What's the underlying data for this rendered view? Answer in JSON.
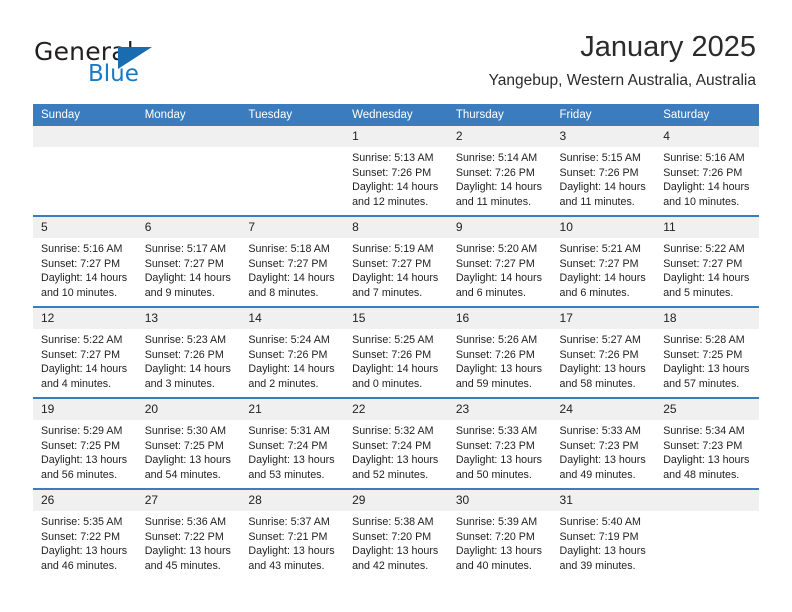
{
  "logo": {
    "word1": "General",
    "word2": "Blue",
    "accent_color": "#1a7ac4"
  },
  "header": {
    "title": "January 2025",
    "subtitle": "Yangebup, Western Australia, Australia"
  },
  "calendar": {
    "header_color": "#3b7cbf",
    "weekday_headers": [
      "Sunday",
      "Monday",
      "Tuesday",
      "Wednesday",
      "Thursday",
      "Friday",
      "Saturday"
    ],
    "weeks": [
      [
        {
          "day": "",
          "lines": []
        },
        {
          "day": "",
          "lines": []
        },
        {
          "day": "",
          "lines": []
        },
        {
          "day": "1",
          "lines": [
            "Sunrise: 5:13 AM",
            "Sunset: 7:26 PM",
            "Daylight: 14 hours",
            "and 12 minutes."
          ]
        },
        {
          "day": "2",
          "lines": [
            "Sunrise: 5:14 AM",
            "Sunset: 7:26 PM",
            "Daylight: 14 hours",
            "and 11 minutes."
          ]
        },
        {
          "day": "3",
          "lines": [
            "Sunrise: 5:15 AM",
            "Sunset: 7:26 PM",
            "Daylight: 14 hours",
            "and 11 minutes."
          ]
        },
        {
          "day": "4",
          "lines": [
            "Sunrise: 5:16 AM",
            "Sunset: 7:26 PM",
            "Daylight: 14 hours",
            "and 10 minutes."
          ]
        }
      ],
      [
        {
          "day": "5",
          "lines": [
            "Sunrise: 5:16 AM",
            "Sunset: 7:27 PM",
            "Daylight: 14 hours",
            "and 10 minutes."
          ]
        },
        {
          "day": "6",
          "lines": [
            "Sunrise: 5:17 AM",
            "Sunset: 7:27 PM",
            "Daylight: 14 hours",
            "and 9 minutes."
          ]
        },
        {
          "day": "7",
          "lines": [
            "Sunrise: 5:18 AM",
            "Sunset: 7:27 PM",
            "Daylight: 14 hours",
            "and 8 minutes."
          ]
        },
        {
          "day": "8",
          "lines": [
            "Sunrise: 5:19 AM",
            "Sunset: 7:27 PM",
            "Daylight: 14 hours",
            "and 7 minutes."
          ]
        },
        {
          "day": "9",
          "lines": [
            "Sunrise: 5:20 AM",
            "Sunset: 7:27 PM",
            "Daylight: 14 hours",
            "and 6 minutes."
          ]
        },
        {
          "day": "10",
          "lines": [
            "Sunrise: 5:21 AM",
            "Sunset: 7:27 PM",
            "Daylight: 14 hours",
            "and 6 minutes."
          ]
        },
        {
          "day": "11",
          "lines": [
            "Sunrise: 5:22 AM",
            "Sunset: 7:27 PM",
            "Daylight: 14 hours",
            "and 5 minutes."
          ]
        }
      ],
      [
        {
          "day": "12",
          "lines": [
            "Sunrise: 5:22 AM",
            "Sunset: 7:27 PM",
            "Daylight: 14 hours",
            "and 4 minutes."
          ]
        },
        {
          "day": "13",
          "lines": [
            "Sunrise: 5:23 AM",
            "Sunset: 7:26 PM",
            "Daylight: 14 hours",
            "and 3 minutes."
          ]
        },
        {
          "day": "14",
          "lines": [
            "Sunrise: 5:24 AM",
            "Sunset: 7:26 PM",
            "Daylight: 14 hours",
            "and 2 minutes."
          ]
        },
        {
          "day": "15",
          "lines": [
            "Sunrise: 5:25 AM",
            "Sunset: 7:26 PM",
            "Daylight: 14 hours",
            "and 0 minutes."
          ]
        },
        {
          "day": "16",
          "lines": [
            "Sunrise: 5:26 AM",
            "Sunset: 7:26 PM",
            "Daylight: 13 hours",
            "and 59 minutes."
          ]
        },
        {
          "day": "17",
          "lines": [
            "Sunrise: 5:27 AM",
            "Sunset: 7:26 PM",
            "Daylight: 13 hours",
            "and 58 minutes."
          ]
        },
        {
          "day": "18",
          "lines": [
            "Sunrise: 5:28 AM",
            "Sunset: 7:25 PM",
            "Daylight: 13 hours",
            "and 57 minutes."
          ]
        }
      ],
      [
        {
          "day": "19",
          "lines": [
            "Sunrise: 5:29 AM",
            "Sunset: 7:25 PM",
            "Daylight: 13 hours",
            "and 56 minutes."
          ]
        },
        {
          "day": "20",
          "lines": [
            "Sunrise: 5:30 AM",
            "Sunset: 7:25 PM",
            "Daylight: 13 hours",
            "and 54 minutes."
          ]
        },
        {
          "day": "21",
          "lines": [
            "Sunrise: 5:31 AM",
            "Sunset: 7:24 PM",
            "Daylight: 13 hours",
            "and 53 minutes."
          ]
        },
        {
          "day": "22",
          "lines": [
            "Sunrise: 5:32 AM",
            "Sunset: 7:24 PM",
            "Daylight: 13 hours",
            "and 52 minutes."
          ]
        },
        {
          "day": "23",
          "lines": [
            "Sunrise: 5:33 AM",
            "Sunset: 7:23 PM",
            "Daylight: 13 hours",
            "and 50 minutes."
          ]
        },
        {
          "day": "24",
          "lines": [
            "Sunrise: 5:33 AM",
            "Sunset: 7:23 PM",
            "Daylight: 13 hours",
            "and 49 minutes."
          ]
        },
        {
          "day": "25",
          "lines": [
            "Sunrise: 5:34 AM",
            "Sunset: 7:23 PM",
            "Daylight: 13 hours",
            "and 48 minutes."
          ]
        }
      ],
      [
        {
          "day": "26",
          "lines": [
            "Sunrise: 5:35 AM",
            "Sunset: 7:22 PM",
            "Daylight: 13 hours",
            "and 46 minutes."
          ]
        },
        {
          "day": "27",
          "lines": [
            "Sunrise: 5:36 AM",
            "Sunset: 7:22 PM",
            "Daylight: 13 hours",
            "and 45 minutes."
          ]
        },
        {
          "day": "28",
          "lines": [
            "Sunrise: 5:37 AM",
            "Sunset: 7:21 PM",
            "Daylight: 13 hours",
            "and 43 minutes."
          ]
        },
        {
          "day": "29",
          "lines": [
            "Sunrise: 5:38 AM",
            "Sunset: 7:20 PM",
            "Daylight: 13 hours",
            "and 42 minutes."
          ]
        },
        {
          "day": "30",
          "lines": [
            "Sunrise: 5:39 AM",
            "Sunset: 7:20 PM",
            "Daylight: 13 hours",
            "and 40 minutes."
          ]
        },
        {
          "day": "31",
          "lines": [
            "Sunrise: 5:40 AM",
            "Sunset: 7:19 PM",
            "Daylight: 13 hours",
            "and 39 minutes."
          ]
        },
        {
          "day": "",
          "lines": []
        }
      ]
    ]
  }
}
